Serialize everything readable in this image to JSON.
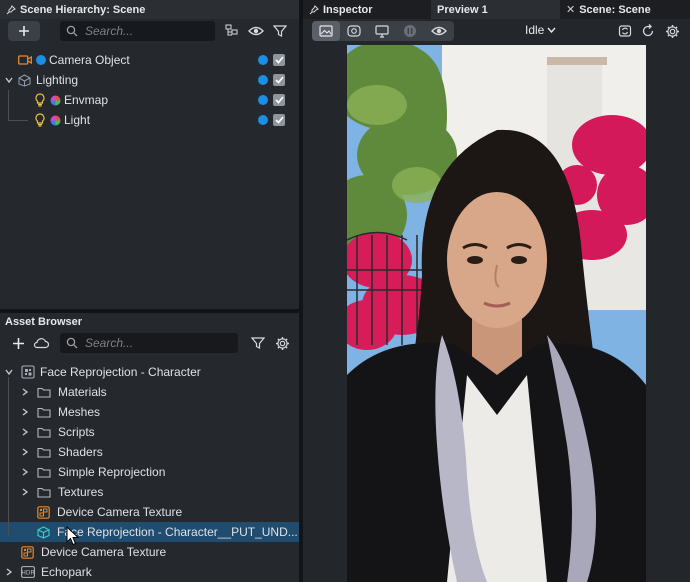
{
  "hierarchy": {
    "tab_title": "Scene Hierarchy: Scene",
    "search_placeholder": "Search...",
    "items": [
      {
        "label": "Camera Object"
      },
      {
        "label": "Lighting"
      },
      {
        "label": "Envmap"
      },
      {
        "label": "Light"
      }
    ]
  },
  "assets": {
    "title": "Asset Browser",
    "search_placeholder": "Search...",
    "items": [
      {
        "label": "Face Reprojection - Character"
      },
      {
        "label": "Materials"
      },
      {
        "label": "Meshes"
      },
      {
        "label": "Scripts"
      },
      {
        "label": "Shaders"
      },
      {
        "label": "Simple Reprojection"
      },
      {
        "label": "Textures"
      },
      {
        "label": "Device Camera Texture"
      },
      {
        "label": "Face Reprojection - Character__PUT_UND..."
      },
      {
        "label": "Device Camera Texture"
      },
      {
        "label": "Echopark"
      }
    ]
  },
  "right_tabs": {
    "inspector": "Inspector",
    "preview": "Preview 1",
    "scene": "Scene: Scene"
  },
  "preview": {
    "state": "Idle"
  },
  "colors": {
    "accent_blue": "#1a8fe3",
    "selection": "#1f4c6f",
    "camera_orange": "#e48a2f",
    "light_yellow": "#e9c13a"
  }
}
